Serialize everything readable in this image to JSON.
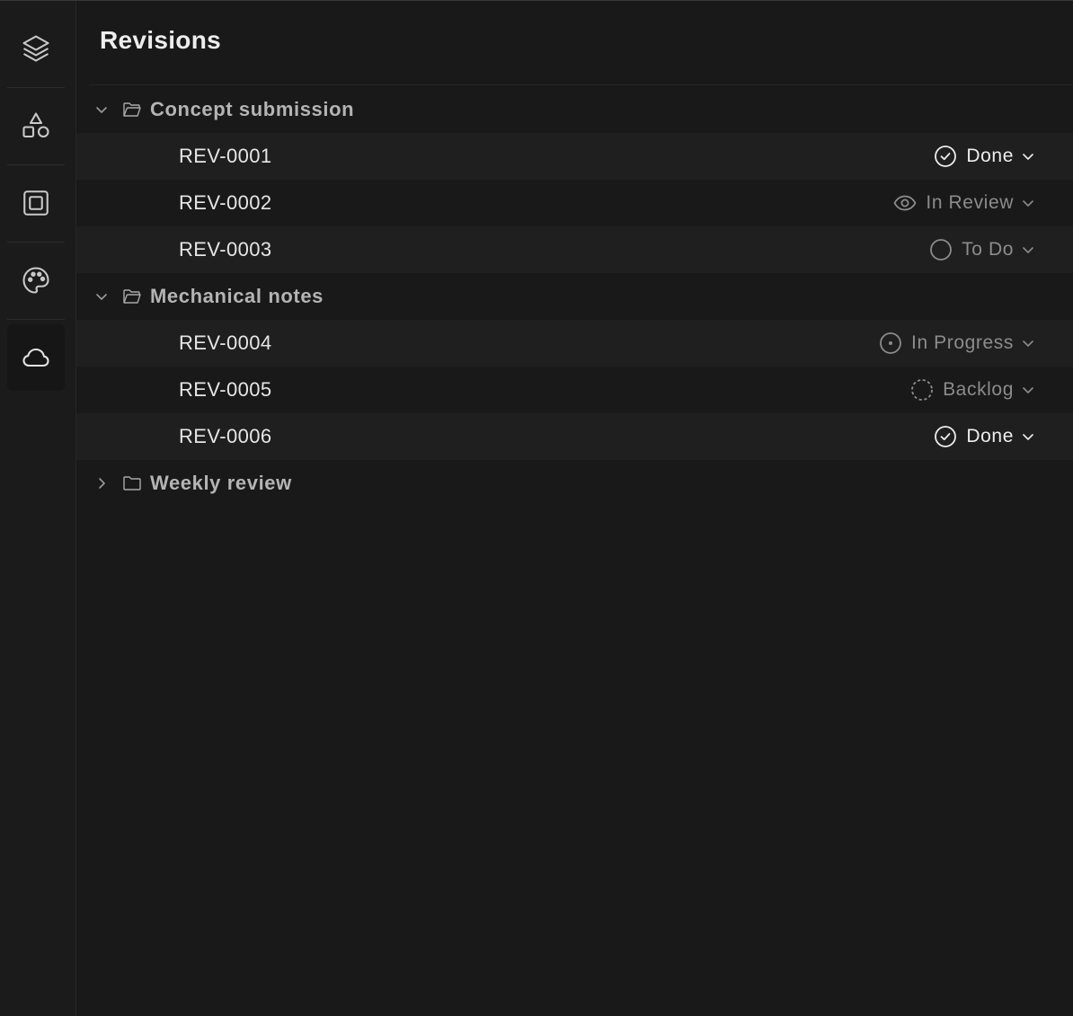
{
  "panel": {
    "title": "Revisions"
  },
  "rail": {
    "items": [
      {
        "icon": "layers-icon"
      },
      {
        "icon": "shapes-icon"
      },
      {
        "icon": "frame-icon"
      },
      {
        "icon": "palette-icon"
      },
      {
        "icon": "cloud-icon",
        "active": true
      }
    ]
  },
  "groups": [
    {
      "label": "Concept submission",
      "expanded": true,
      "items": [
        {
          "id": "REV-0001",
          "status": "Done",
          "status_icon": "check-circle-icon"
        },
        {
          "id": "REV-0002",
          "status": "In Review",
          "status_icon": "eye-icon"
        },
        {
          "id": "REV-0003",
          "status": "To Do",
          "status_icon": "empty-circle-icon"
        }
      ]
    },
    {
      "label": "Mechanical notes",
      "expanded": true,
      "items": [
        {
          "id": "REV-0004",
          "status": "In Progress",
          "status_icon": "dot-circle-icon"
        },
        {
          "id": "REV-0005",
          "status": "Backlog",
          "status_icon": "dashed-circle-icon"
        },
        {
          "id": "REV-0006",
          "status": "Done",
          "status_icon": "check-circle-icon"
        }
      ]
    },
    {
      "label": "Weekly review",
      "expanded": false,
      "items": []
    }
  ],
  "colors": {
    "background": "#191919",
    "text_primary": "#e6e6e6",
    "text_muted": "#8c8c8c"
  }
}
